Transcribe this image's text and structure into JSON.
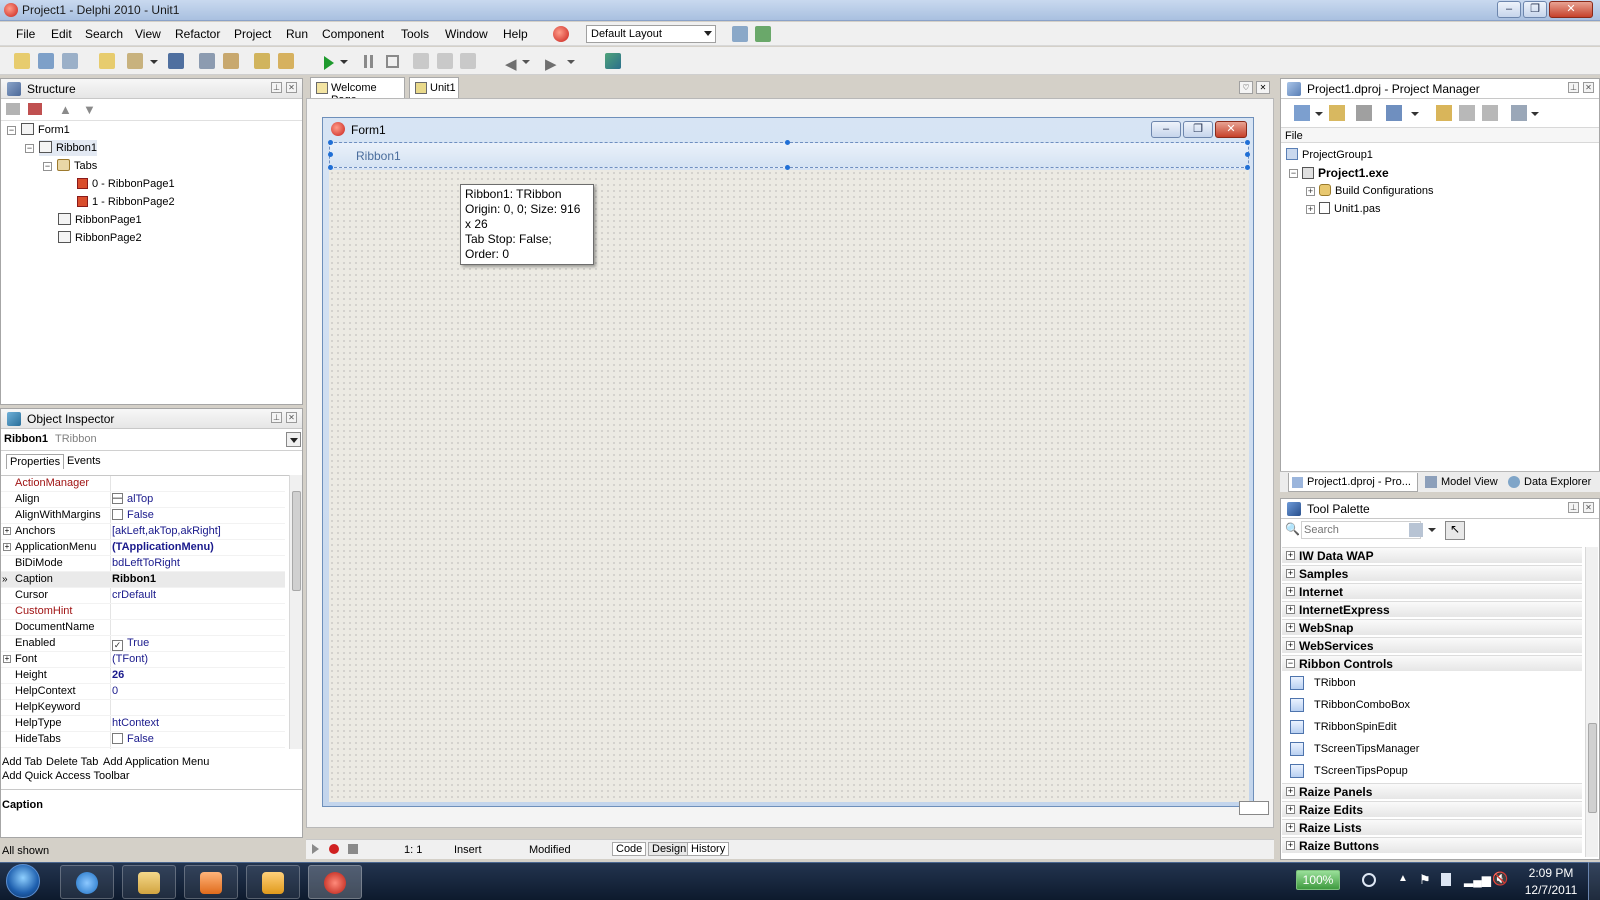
{
  "window": {
    "title": "Project1 - Delphi 2010 - Unit1"
  },
  "menu": [
    "File",
    "Edit",
    "Search",
    "View",
    "Refactor",
    "Project",
    "Run",
    "Component",
    "Tools",
    "Window",
    "Help"
  ],
  "layout": {
    "value": "Default Layout"
  },
  "structure": {
    "title": "Structure",
    "items": [
      "Form1",
      "Ribbon1",
      "Tabs",
      "0 - RibbonPage1",
      "1 - RibbonPage2",
      "RibbonPage1",
      "RibbonPage2"
    ]
  },
  "objectInspector": {
    "title": "Object Inspector",
    "selectedName": "Ribbon1",
    "selectedType": "TRibbon",
    "tabs": [
      "Properties",
      "Events"
    ],
    "rows": [
      {
        "name": "ActionManager",
        "value": ""
      },
      {
        "name": "Align",
        "value": "alTop"
      },
      {
        "name": "AlignWithMargins",
        "value": "False"
      },
      {
        "name": "Anchors",
        "value": "[akLeft,akTop,akRight]"
      },
      {
        "name": "ApplicationMenu",
        "value": "(TApplicationMenu)"
      },
      {
        "name": "BiDiMode",
        "value": "bdLeftToRight"
      },
      {
        "name": "Caption",
        "value": "Ribbon1"
      },
      {
        "name": "Cursor",
        "value": "crDefault"
      },
      {
        "name": "CustomHint",
        "value": ""
      },
      {
        "name": "DocumentName",
        "value": ""
      },
      {
        "name": "Enabled",
        "value": "True"
      },
      {
        "name": "Font",
        "value": "(TFont)"
      },
      {
        "name": "Height",
        "value": "26"
      },
      {
        "name": "HelpContext",
        "value": "0"
      },
      {
        "name": "HelpKeyword",
        "value": ""
      },
      {
        "name": "HelpType",
        "value": "htContext"
      },
      {
        "name": "HideTabs",
        "value": "False"
      }
    ],
    "verbs": {
      "addTab": "Add Tab",
      "deleteTab": "Delete Tab",
      "addAppMenu": "Add Application Menu",
      "addQAT": "Add Quick Access Toolbar"
    },
    "descTitle": "Caption",
    "allShown": "All shown"
  },
  "designer": {
    "tabs": [
      "Welcome Page",
      "Unit1"
    ],
    "formTitle": "Form1",
    "ribbonCaption": "Ribbon1",
    "tooltip": {
      "line1": "Ribbon1: TRibbon",
      "line2": "Origin: 0, 0; Size: 916 x 26",
      "line3": "Tab Stop: False; Order: 0"
    },
    "status": {
      "pos": "1:   1",
      "mode": "Insert",
      "modified": "Modified"
    },
    "bottomTabs": [
      "Code",
      "Design",
      "History"
    ]
  },
  "projectManager": {
    "title": "Project1.dproj - Project Manager",
    "header": "File",
    "tree": [
      "ProjectGroup1",
      "Project1.exe",
      "Build Configurations",
      "Unit1.pas"
    ],
    "tabs": [
      "Project1.dproj - Pro...",
      "Model View",
      "Data Explorer"
    ]
  },
  "toolPalette": {
    "title": "Tool Palette",
    "searchPlaceholder": "Search",
    "categoriesTop": [
      "IW Data WAP",
      "Samples",
      "Internet",
      "InternetExpress",
      "WebSnap",
      "WebServices",
      "Ribbon Controls"
    ],
    "components": [
      "TRibbon",
      "TRibbonComboBox",
      "TRibbonSpinEdit",
      "TScreenTipsManager",
      "TScreenTipsPopup"
    ],
    "categoriesBottom": [
      "Raize Panels",
      "Raize Edits",
      "Raize Lists",
      "Raize Buttons"
    ]
  },
  "taskbar": {
    "time": "2:09 PM",
    "date": "12/7/2011",
    "battery": "100%"
  }
}
